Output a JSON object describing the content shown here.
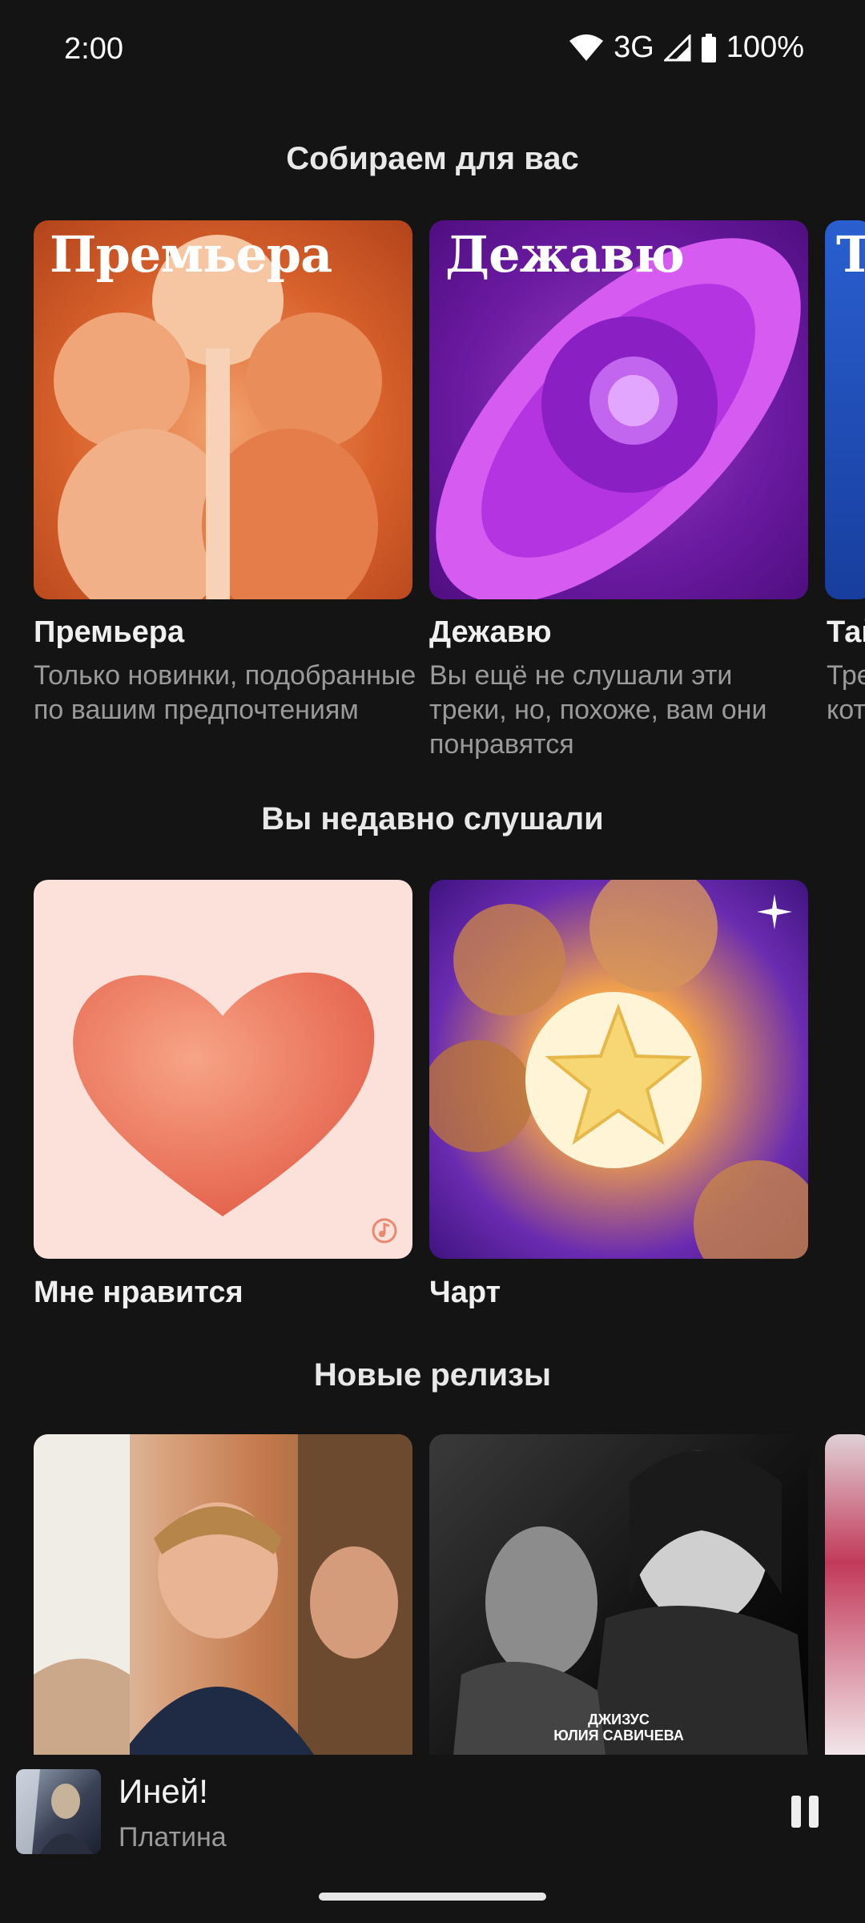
{
  "status": {
    "time": "2:00",
    "network": "3G",
    "battery": "100%"
  },
  "sections": {
    "for_you": {
      "title": "Собираем для вас"
    },
    "recent": {
      "title": "Вы недавно слушали"
    },
    "new_releases": {
      "title": "Новые релизы"
    }
  },
  "for_you_cards": [
    {
      "cover_label": "Премьера",
      "title": "Премьера",
      "desc": "Только новинки, подобранные по вашим предпочтениям"
    },
    {
      "cover_label": "Дежавю",
      "title": "Дежавю",
      "desc": "Вы ещё не слушали эти треки, но, похоже, вам они понравятся"
    },
    {
      "cover_label": "Т",
      "title": "Тай",
      "desc": "Тре кот"
    }
  ],
  "recent_cards": [
    {
      "title": "Мне нравится"
    },
    {
      "title": "Чарт"
    }
  ],
  "release_cards": [
    {
      "cover_text_1": "ДЖИЗУС",
      "cover_text_2": "ЮЛИЯ САВИЧЕВА"
    }
  ],
  "player": {
    "title": "Иней!",
    "artist": "Платина"
  }
}
